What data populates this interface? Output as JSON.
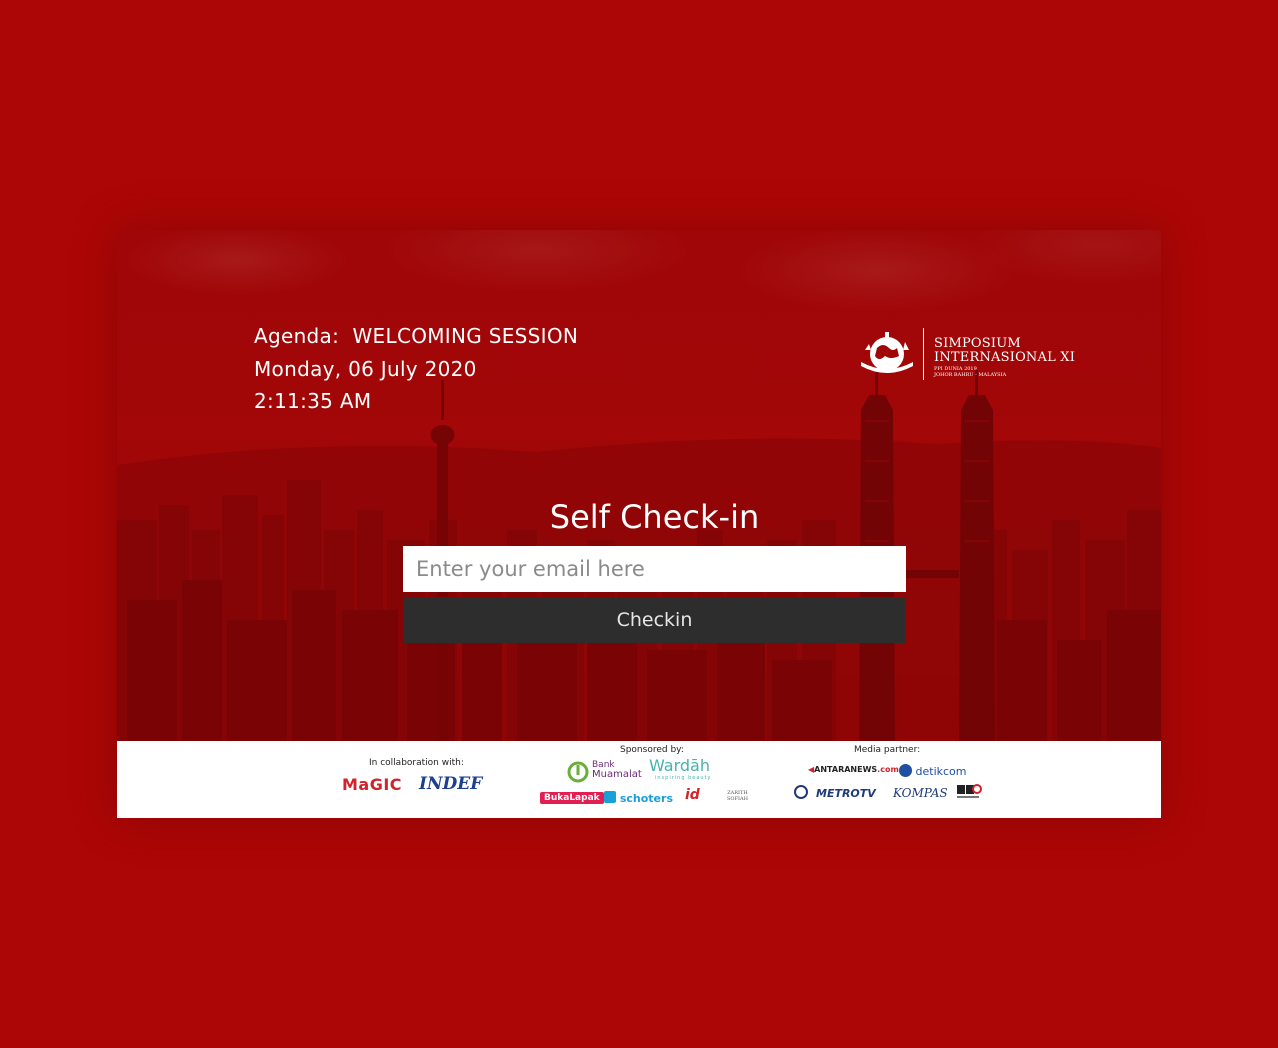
{
  "agenda": {
    "prefix": "Agenda:",
    "session": "WELCOMING SESSION",
    "date": "Monday, 06 July 2020",
    "time": "2:11:35 AM"
  },
  "brand": {
    "line1": "SIMPOSIUM",
    "line2": "INTERNASIONAL XI",
    "line3": "PPI DUNIA 2019",
    "line4": "JOHOR BAHRU - MALAYSIA",
    "emblem": "globe-emblem-icon"
  },
  "checkin": {
    "title": "Self Check-in",
    "email_placeholder": "Enter your email here",
    "email_value": "",
    "button_label": "Checkin"
  },
  "footer": {
    "collaboration": {
      "heading": "In collaboration with:",
      "logos": [
        "MaGIC",
        "INDEF"
      ]
    },
    "sponsors": {
      "heading": "Sponsored by:",
      "bank_line1": "Bank",
      "bank_line2": "Muamalat",
      "wardah": "Wardāh",
      "wardah_tag": "inspiring beauty",
      "bukalapak": "BukaLapak",
      "schoters": "schoters",
      "identity": "id",
      "zarith1": "ZARITH",
      "zarith2": "SOFIAH"
    },
    "media": {
      "heading": "Media partner:",
      "antara": "ANTARANEWS",
      "antara_dom": ".com",
      "detik": "detikcom",
      "metro": "METROTV",
      "kompas": "KOMPAS"
    }
  },
  "colors": {
    "background": "#ad0606",
    "hero_red": "#a00608",
    "button": "#2d2d2d"
  }
}
